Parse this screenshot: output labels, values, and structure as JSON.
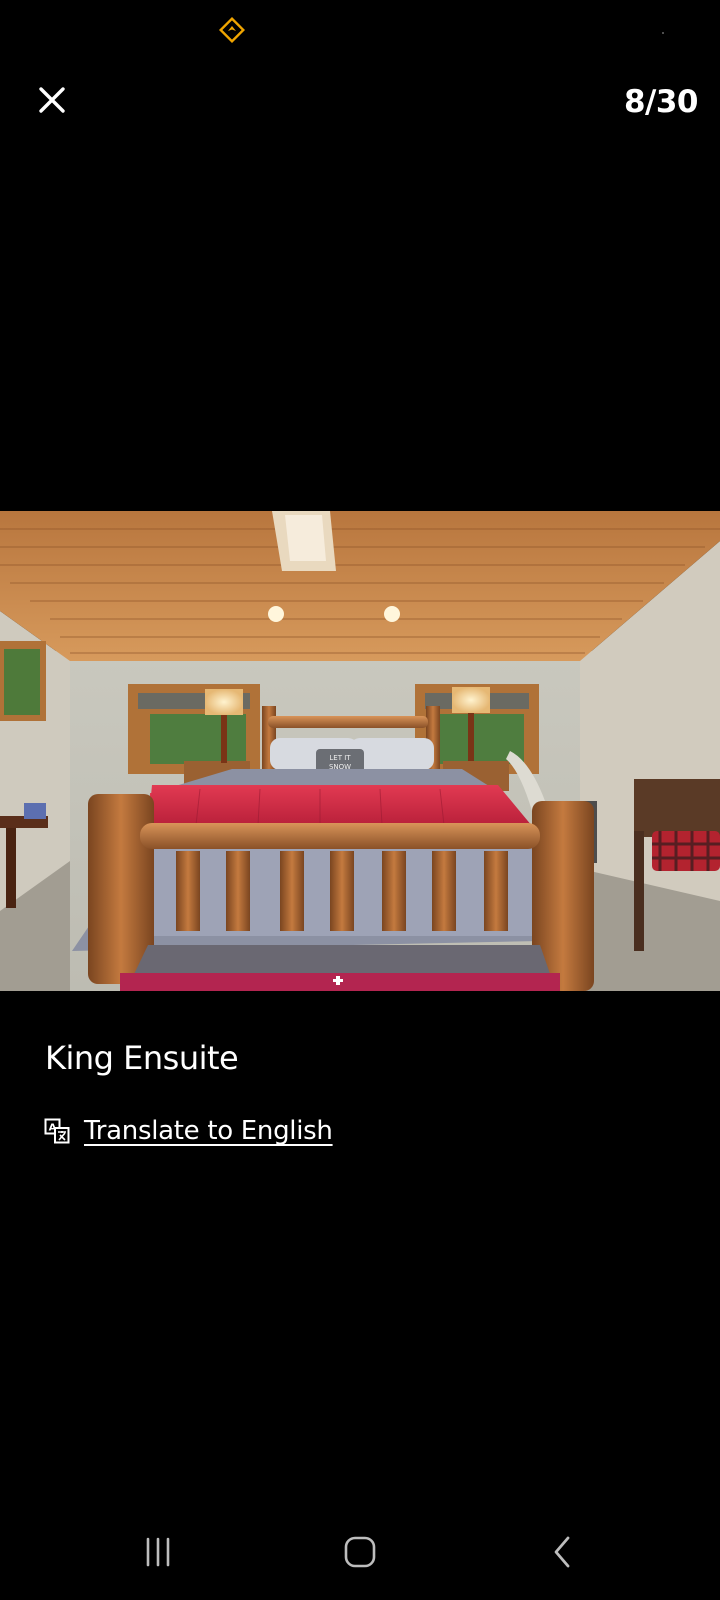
{
  "status_bar": {
    "notification_icon": "navigation-diamond-icon",
    "accent_color": "#f0a500"
  },
  "viewer": {
    "close_icon": "close-icon",
    "counter": "8/30",
    "caption": "King Ensuite",
    "translate_icon": "translate-icon",
    "translate_label": "Translate to English"
  },
  "photo": {
    "subject": "photo",
    "pillow_text": "LET IT SNOW"
  },
  "nav_bar": {
    "recents_icon": "recents-icon",
    "home_icon": "home-icon",
    "back_icon": "back-icon"
  }
}
